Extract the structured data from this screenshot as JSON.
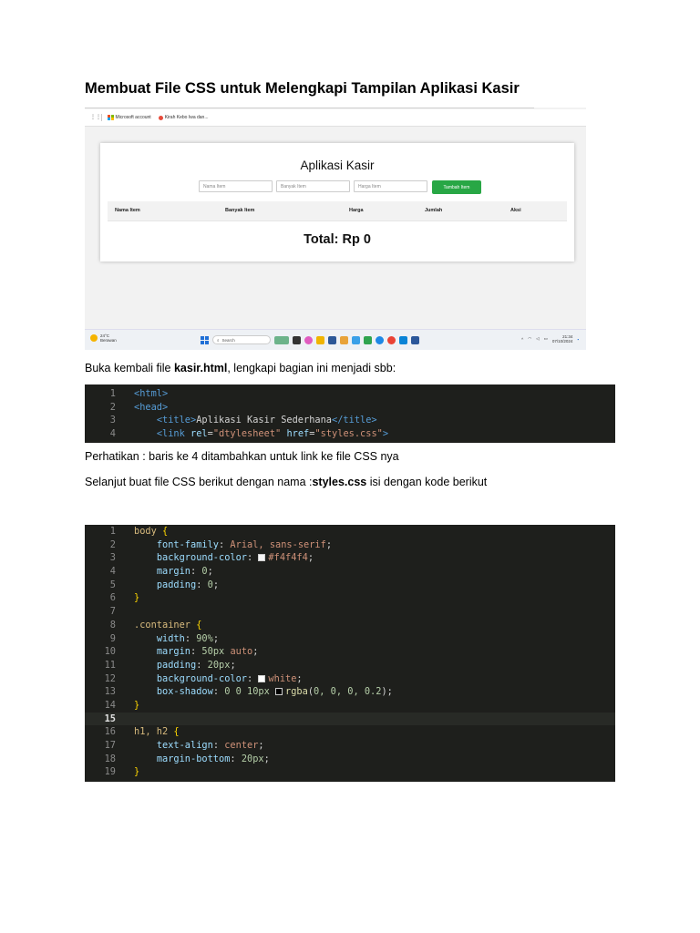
{
  "heading": "Membuat File CSS untuk Melengkapi Tampilan Aplikasi Kasir",
  "screenshot": {
    "bookmarks": {
      "item1": "Microsoft account",
      "item2": "Kirah Kebo Iwa dan..."
    },
    "app_title": "Aplikasi Kasir",
    "placeholders": [
      "Nama Item",
      "Banyak Item",
      "Harga Item"
    ],
    "add_button": "Tambah Item",
    "columns": [
      "Nama Item",
      "Banyak Item",
      "Harga",
      "Jumlah",
      "Aksi"
    ],
    "total": "Total: Rp 0",
    "taskbar": {
      "temp": "24°C",
      "weather": "Berawan",
      "search": "Search",
      "time": "21:34",
      "date": "07/10/2024"
    }
  },
  "para1": {
    "before": "Buka kembali file ",
    "bold": "kasir.html",
    "after": ", lengkapi bagian ini menjadi sbb:"
  },
  "code_html": {
    "lines": [
      {
        "n": "1",
        "parts": [
          [
            "c-tag",
            "<html>"
          ]
        ]
      },
      {
        "n": "2",
        "parts": [
          [
            "c-tag",
            "<head>"
          ]
        ]
      },
      {
        "n": "3",
        "parts": [
          [
            "c-txt",
            "    "
          ],
          [
            "c-tag",
            "<title>"
          ],
          [
            "c-txt",
            "Aplikasi Kasir Sederhana"
          ],
          [
            "c-tag",
            "</title>"
          ]
        ]
      },
      {
        "n": "4",
        "parts": [
          [
            "c-txt",
            "    "
          ],
          [
            "c-tag",
            "<link "
          ],
          [
            "c-attr",
            "rel"
          ],
          [
            "c-txt",
            "="
          ],
          [
            "c-str",
            "\"dtylesheet\""
          ],
          [
            "c-txt",
            " "
          ],
          [
            "c-attr",
            "href"
          ],
          [
            "c-txt",
            "="
          ],
          [
            "c-str",
            "\"styles.css\""
          ],
          [
            "c-tag",
            ">"
          ]
        ]
      }
    ]
  },
  "para2": "Perhatikan : baris ke 4 ditambahkan untuk link ke file CSS nya",
  "para3": {
    "before": "Selanjut buat file CSS berikut dengan nama :",
    "bold": "styles.css",
    "after": " isi dengan kode berikut"
  },
  "code_css": {
    "lines": [
      {
        "n": "1",
        "parts": [
          [
            "c-sel",
            "body "
          ],
          [
            "c-brace",
            "{"
          ]
        ]
      },
      {
        "n": "2",
        "parts": [
          [
            "c-txt",
            "    "
          ],
          [
            "c-prop",
            "font-family"
          ],
          [
            "c-punc",
            ": "
          ],
          [
            "c-val",
            "Arial, sans-serif"
          ],
          [
            "c-punc",
            ";"
          ]
        ]
      },
      {
        "n": "3",
        "parts": [
          [
            "c-txt",
            "    "
          ],
          [
            "c-prop",
            "background-color"
          ],
          [
            "c-punc",
            ": "
          ],
          [
            "swatch",
            "#f4f4f4"
          ],
          [
            "c-val",
            "#f4f4f4"
          ],
          [
            "c-punc",
            ";"
          ]
        ]
      },
      {
        "n": "4",
        "parts": [
          [
            "c-txt",
            "    "
          ],
          [
            "c-prop",
            "margin"
          ],
          [
            "c-punc",
            ": "
          ],
          [
            "c-num",
            "0"
          ],
          [
            "c-punc",
            ";"
          ]
        ]
      },
      {
        "n": "5",
        "parts": [
          [
            "c-txt",
            "    "
          ],
          [
            "c-prop",
            "padding"
          ],
          [
            "c-punc",
            ": "
          ],
          [
            "c-num",
            "0"
          ],
          [
            "c-punc",
            ";"
          ]
        ]
      },
      {
        "n": "6",
        "parts": [
          [
            "c-brace",
            "}"
          ]
        ]
      },
      {
        "n": "7",
        "parts": []
      },
      {
        "n": "8",
        "parts": [
          [
            "c-sel",
            ".container "
          ],
          [
            "c-brace",
            "{"
          ]
        ]
      },
      {
        "n": "9",
        "parts": [
          [
            "c-txt",
            "    "
          ],
          [
            "c-prop",
            "width"
          ],
          [
            "c-punc",
            ": "
          ],
          [
            "c-num",
            "90%"
          ],
          [
            "c-punc",
            ";"
          ]
        ]
      },
      {
        "n": "10",
        "parts": [
          [
            "c-txt",
            "    "
          ],
          [
            "c-prop",
            "margin"
          ],
          [
            "c-punc",
            ": "
          ],
          [
            "c-num",
            "50px"
          ],
          [
            "c-txt",
            " "
          ],
          [
            "c-val",
            "auto"
          ],
          [
            "c-punc",
            ";"
          ]
        ]
      },
      {
        "n": "11",
        "parts": [
          [
            "c-txt",
            "    "
          ],
          [
            "c-prop",
            "padding"
          ],
          [
            "c-punc",
            ": "
          ],
          [
            "c-num",
            "20px"
          ],
          [
            "c-punc",
            ";"
          ]
        ]
      },
      {
        "n": "12",
        "parts": [
          [
            "c-txt",
            "    "
          ],
          [
            "c-prop",
            "background-color"
          ],
          [
            "c-punc",
            ": "
          ],
          [
            "swatch",
            "#ffffff"
          ],
          [
            "c-val",
            "white"
          ],
          [
            "c-punc",
            ";"
          ]
        ]
      },
      {
        "n": "13",
        "parts": [
          [
            "c-txt",
            "    "
          ],
          [
            "c-prop",
            "box-shadow"
          ],
          [
            "c-punc",
            ": "
          ],
          [
            "c-num",
            "0 0 10px"
          ],
          [
            "c-txt",
            " "
          ],
          [
            "swatch",
            "#000000"
          ],
          [
            "c-fn",
            "rgba"
          ],
          [
            "c-punc",
            "("
          ],
          [
            "c-num",
            "0, 0, 0, 0.2"
          ],
          [
            "c-punc",
            ");"
          ]
        ]
      },
      {
        "n": "14",
        "parts": [
          [
            "c-brace",
            "}"
          ]
        ]
      },
      {
        "n": "15",
        "parts": [],
        "active": true
      },
      {
        "n": "16",
        "parts": [
          [
            "c-sel",
            "h1, h2 "
          ],
          [
            "c-brace",
            "{"
          ]
        ]
      },
      {
        "n": "17",
        "parts": [
          [
            "c-txt",
            "    "
          ],
          [
            "c-prop",
            "text-align"
          ],
          [
            "c-punc",
            ": "
          ],
          [
            "c-val",
            "center"
          ],
          [
            "c-punc",
            ";"
          ]
        ]
      },
      {
        "n": "18",
        "parts": [
          [
            "c-txt",
            "    "
          ],
          [
            "c-prop",
            "margin-bottom"
          ],
          [
            "c-punc",
            ": "
          ],
          [
            "c-num",
            "20px"
          ],
          [
            "c-punc",
            ";"
          ]
        ]
      },
      {
        "n": "19",
        "parts": [
          [
            "c-brace",
            "}"
          ]
        ]
      }
    ]
  }
}
